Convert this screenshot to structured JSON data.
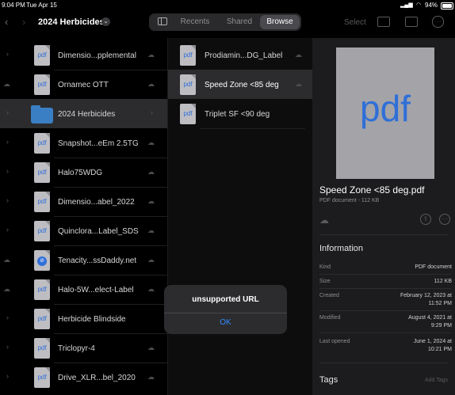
{
  "status": {
    "time": "9:04 PM",
    "date": "Tue Apr 15",
    "battery": "94%"
  },
  "toolbar": {
    "title": "2024 Herbicides",
    "tabs": [
      "Recents",
      "Shared",
      "Browse"
    ],
    "active_tab": "Browse",
    "select_label": "Select"
  },
  "files": [
    {
      "name": "Dimensio...pplemental",
      "type": "pdf"
    },
    {
      "name": "Ornamec OTT",
      "type": "pdf"
    },
    {
      "name": "2024 Herbicides",
      "type": "folder"
    },
    {
      "name": "Snapshot...eEm 2.5TG",
      "type": "pdf"
    },
    {
      "name": "Halo75WDG",
      "type": "pdf"
    },
    {
      "name": "Dimensio...abel_2022",
      "type": "pdf"
    },
    {
      "name": "Quinclora...Label_SDS",
      "type": "pdf"
    },
    {
      "name": "Tenacity...ssDaddy.net",
      "type": "compass"
    },
    {
      "name": "Halo-5W...elect-Label",
      "type": "pdf"
    },
    {
      "name": "Herbicide Blindside",
      "type": "pdf"
    },
    {
      "name": "Triclopyr-4",
      "type": "pdf"
    },
    {
      "name": "Drive_XLR...bel_2020",
      "type": "pdf"
    }
  ],
  "subfiles": [
    {
      "name": "Prodiamin...DG_Label"
    },
    {
      "name": "Speed Zone <85 deg"
    },
    {
      "name": "Triplet SF <90 deg"
    }
  ],
  "doc_type_label": "pdf",
  "preview": {
    "title": "Speed Zone <85 deg.pdf",
    "subtitle": "PDF document - 112 KB",
    "information_header": "Information",
    "rows": [
      {
        "label": "Kind",
        "value": "PDF document"
      },
      {
        "label": "Size",
        "value": "112 KB"
      },
      {
        "label": "Created",
        "value": "February 12, 2023 at",
        "value2": "11:52 PM"
      },
      {
        "label": "Modified",
        "value": "August 4, 2021 at",
        "value2": "9:29 PM"
      },
      {
        "label": "Last opened",
        "value": "June 1, 2024 at",
        "value2": "10:21 PM"
      }
    ],
    "tags_header": "Tags",
    "add_tags": "Add Tags"
  },
  "alert": {
    "title": "unsupported URL",
    "ok": "OK"
  }
}
